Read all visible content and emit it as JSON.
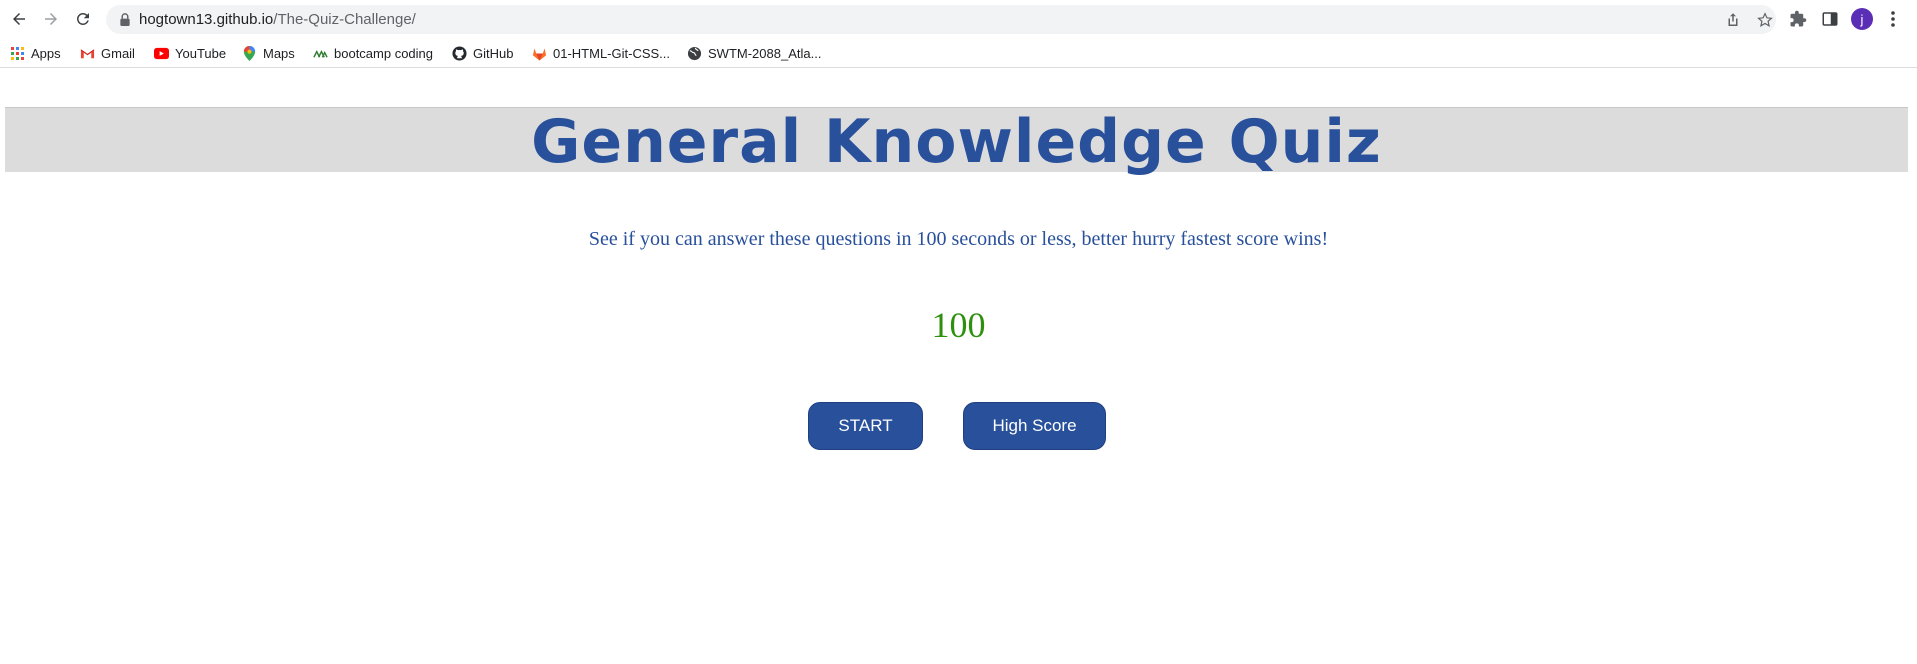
{
  "browser": {
    "url_host": "hogtown13.github.io",
    "url_path": "/The-Quiz-Challenge/",
    "profile_initial": "j"
  },
  "bookmarks": [
    {
      "label": "Apps",
      "icon": "apps-grid-icon"
    },
    {
      "label": "Gmail",
      "icon": "gmail-icon"
    },
    {
      "label": "YouTube",
      "icon": "youtube-icon"
    },
    {
      "label": "Maps",
      "icon": "maps-pin-icon"
    },
    {
      "label": "bootcamp coding",
      "icon": "bootcamp-icon"
    },
    {
      "label": "GitHub",
      "icon": "github-icon"
    },
    {
      "label": "01-HTML-Git-CSS...",
      "icon": "gitlab-icon"
    },
    {
      "label": "SWTM-2088_Atla...",
      "icon": "globe-icon"
    }
  ],
  "page": {
    "title": "General Knowledge Quiz",
    "subtitle": "See if you can answer these questions in 100 seconds or less, better hurry fastest score wins!",
    "timer": "100",
    "start_label": "START",
    "highscore_label": "High Score"
  },
  "colors": {
    "accent": "#28509b",
    "timer": "#2f8f0f",
    "header_band": "#dcdcdc"
  }
}
